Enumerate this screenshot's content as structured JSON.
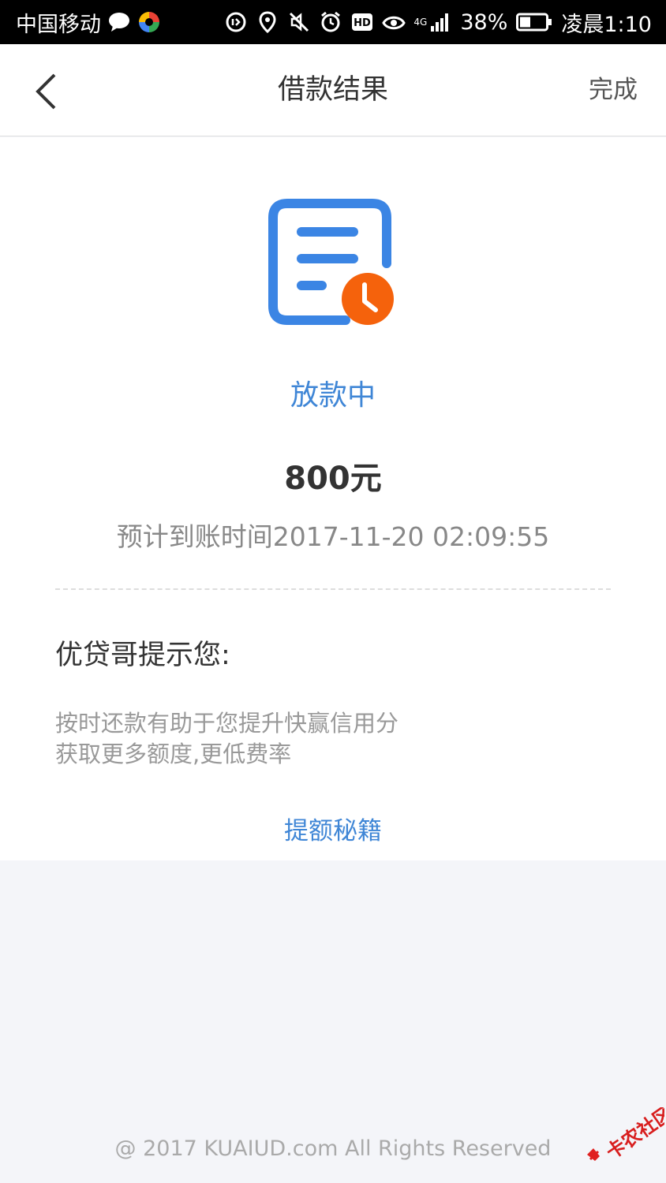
{
  "status_bar": {
    "carrier": "中国移动",
    "network": "4G",
    "battery": "38%",
    "time": "凌晨1:10",
    "icons": [
      "message-icon",
      "app-icon",
      "data-saver-icon",
      "location-icon",
      "mute-icon",
      "alarm-icon",
      "hd-icon",
      "eye-icon",
      "signal-icon",
      "battery-icon"
    ]
  },
  "nav": {
    "title": "借款结果",
    "done_label": "完成",
    "back_icon": "chevron-left-icon"
  },
  "result": {
    "icon": "document-clock-icon",
    "status": "放款中",
    "amount": "800元",
    "eta_label": "预计到账时间",
    "eta_value": "2017-11-20 02:09:55"
  },
  "tips": {
    "title": "优贷哥提示您:",
    "lines": [
      "按时还款有助于您提升快赢信用分",
      "获取更多额度,更低费率"
    ],
    "link_label": "提额秘籍"
  },
  "footer": {
    "copyright": "@ 2017 KUAIUD.com All Rights Reserved",
    "watermark": "卡农社区"
  },
  "colors": {
    "accent": "#3f86d6",
    "icon_blue": "#3b85e4",
    "icon_orange": "#f5620c"
  }
}
